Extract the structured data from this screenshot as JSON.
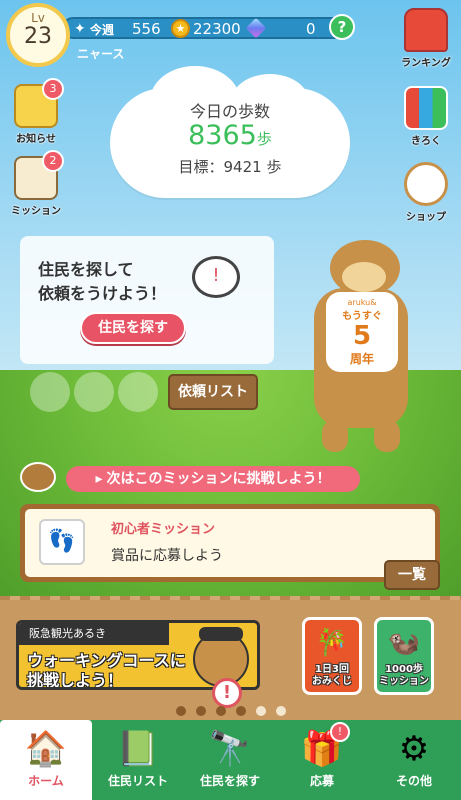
{
  "header": {
    "level_label": "Lv",
    "level": "23",
    "username": "ニャース",
    "week_label": "今週",
    "steps": "556",
    "coins": "22300",
    "gems": "0",
    "help": "?"
  },
  "side_left": [
    {
      "label": "お知らせ",
      "badge": "3"
    },
    {
      "label": "ミッション",
      "badge": "2"
    }
  ],
  "side_right": [
    {
      "label": "ランキング"
    },
    {
      "label": "きろく"
    },
    {
      "label": "ショップ"
    }
  ],
  "steps_cloud": {
    "title": "今日の歩数",
    "steps": "8365",
    "unit": "歩",
    "goal": "目標：9421 歩"
  },
  "resident_bubble": {
    "line1": "住民を探して",
    "line2": "依頼をうけよう！",
    "button": "住民を探す"
  },
  "request_list_button": "依頼リスト",
  "otter_shirt": {
    "brand": "aruku&",
    "line1": "もうすぐ",
    "line2": "5",
    "line3": "周年"
  },
  "mission_prompt": "次はこのミッションに挑戦しよう！",
  "mission_card": {
    "title": "初心者ミッション",
    "desc": "賞品に応募しよう",
    "more_button": "一覧"
  },
  "banner": {
    "top": "阪急観光あるき",
    "line1": "ウォーキングコースに",
    "line2": "挑戦しよう！"
  },
  "tiles": [
    {
      "label": "1日3回\nおみくじ",
      "color": "#e8562a"
    },
    {
      "label": "1000歩\nミッション",
      "color": "#3cb26a"
    }
  ],
  "page_dots": 6,
  "page_dots_active": 4,
  "tabbar": [
    {
      "label": "ホーム",
      "active": true
    },
    {
      "label": "住民リスト"
    },
    {
      "label": "住民を探す"
    },
    {
      "label": "応募",
      "badge": "!"
    },
    {
      "label": "その他"
    }
  ]
}
